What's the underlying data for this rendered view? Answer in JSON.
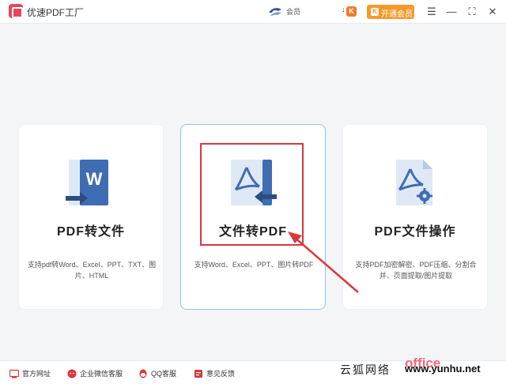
{
  "app": {
    "title": "优速PDF工厂",
    "user_name": "会员",
    "k_badge": "K",
    "k_arrow": "↓",
    "vip_label": "开通会员",
    "vip_icon": "K",
    "colors": {
      "accent": "#e8455a",
      "vip": "#f39a2b",
      "icon_blue": "#3f6db3"
    }
  },
  "window_controls": {
    "menu": "☰",
    "minimize": "—",
    "maximize": "⛶",
    "close": "✕"
  },
  "cards": [
    {
      "title": "PDF转文件",
      "desc": "支持pdf转Word、Excel、PPT、TXT、图片、HTML",
      "icon": "word-document-icon"
    },
    {
      "title": "文件转PDF",
      "desc": "支持Word、Excel、PPT、图片转PDF",
      "icon": "pdf-convert-icon"
    },
    {
      "title": "PDF文件操作",
      "desc": "支持PDF加密解密、PDF压缩、分割合并、页面提取/图片提取",
      "icon": "pdf-settings-icon"
    }
  ],
  "footer": {
    "items": [
      {
        "label": "官方网址",
        "icon": "website-icon"
      },
      {
        "label": "企业微信客服",
        "icon": "wechat-icon"
      },
      {
        "label": "QQ客服",
        "icon": "qq-icon"
      },
      {
        "label": "意见反馈",
        "icon": "feedback-icon"
      }
    ]
  },
  "watermark": {
    "text": "云狐网络",
    "office": "office",
    "url": "www.yunhu.net"
  }
}
